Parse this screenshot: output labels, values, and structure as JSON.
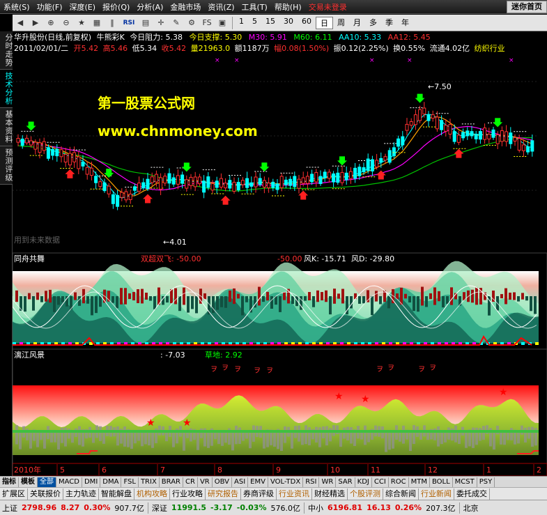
{
  "menu": {
    "items": [
      "系统(S)",
      "功能(F)",
      "深度(E)",
      "报价(Q)",
      "分析(A)",
      "金融市场",
      "资讯(Z)",
      "工具(T)",
      "帮助(H)",
      "交易未登录"
    ],
    "mini_button": "迷你首页"
  },
  "toolbar": {
    "rsi_label": "RSI",
    "fs_label": "FS",
    "periods": [
      "1",
      "5",
      "15",
      "30",
      "60",
      "日",
      "周",
      "月",
      "多",
      "季",
      "年"
    ],
    "active_period": "日"
  },
  "side_tabs": [
    "分时走势",
    "技术分析",
    "基本资料",
    "预测评级"
  ],
  "active_side_tab": "技术分析",
  "main_panel": {
    "header_line1": {
      "stock": "华升股份(日线,前复权)",
      "indicator": "牛熊彩K",
      "resist_label": "今日阻力: 5.38",
      "support_label": "今日支撑: 5.30",
      "m30": "M30: 5.91",
      "m60": "M60: 6.11",
      "aa10": "AA10: 5.33",
      "aa12": "AA12: 5.45"
    },
    "header_line2": {
      "date": "2011/02/01/二",
      "open": "开5.42",
      "high": "高5.46",
      "low": "低5.34",
      "close": "收5.42",
      "volume": "量21963.0",
      "amount": "额1187万",
      "change": "幅0.08(1.50%)",
      "amplitude": "振0.12(2.25%)",
      "turnover": "换0.55%",
      "float": "流通4.02亿",
      "industry": "纺织行业"
    },
    "watermark_title": "第一股票公式网",
    "watermark_url": "www.chnmoney.com",
    "high_label": "7.50",
    "low_label": "4.01",
    "future_label": "用到未来数据",
    "colors": {
      "red": "#ff3030",
      "green": "#00ff00",
      "yellow": "#ffff00",
      "magenta": "#ff00ff",
      "cyan": "#00ffff"
    }
  },
  "panel2": {
    "title": "同舟共舞",
    "label1": "双超双飞: -50.00",
    "label2": "-50.00",
    "label3": "风K: -15.71",
    "label4": "风D: -29.80"
  },
  "panel3": {
    "title": "漓江风景",
    "value1": ": -7.03",
    "value2": "草地: 2.92"
  },
  "x_axis": {
    "year_label": "2010年",
    "ticks": [
      "5",
      "6",
      "7",
      "8",
      "9",
      "10",
      "11",
      "12",
      "1",
      "2"
    ]
  },
  "indicator_tabs": [
    "指标",
    "模板",
    "全部",
    "MACD",
    "DMI",
    "DMA",
    "FSL",
    "TRIX",
    "BRAR",
    "CR",
    "VR",
    "OBV",
    "ASI",
    "EMV",
    "VOL-TDX",
    "RSI",
    "WR",
    "SAR",
    "KDJ",
    "CCI",
    "ROC",
    "MTM",
    "BOLL",
    "MCST",
    "PSY"
  ],
  "active_indicator_tab": "全部",
  "function_tabs": [
    "扩展区",
    "关联报价",
    "主力轨迹",
    "智能解盘",
    "机构攻略",
    "行业攻略",
    "研究报告",
    "券商评级",
    "行业资讯",
    "财经精选",
    "个股评测",
    "综合新闻",
    "行业新闻",
    "委托成交"
  ],
  "status": {
    "sh_label": "上证",
    "sh_value": "2798.96",
    "sh_change": "8.27",
    "sh_pct": "0.30%",
    "sh_amount": "907.7亿",
    "sz_label": "深证",
    "sz_value": "11991.5",
    "sz_change": "-3.17",
    "sz_pct": "-0.03%",
    "sz_amount": "576.0亿",
    "zx_label": "中小",
    "zx_value": "6196.81",
    "zx_change": "16.13",
    "zx_pct": "0.26%",
    "zx_amount": "207.3亿",
    "city": "北京"
  }
}
